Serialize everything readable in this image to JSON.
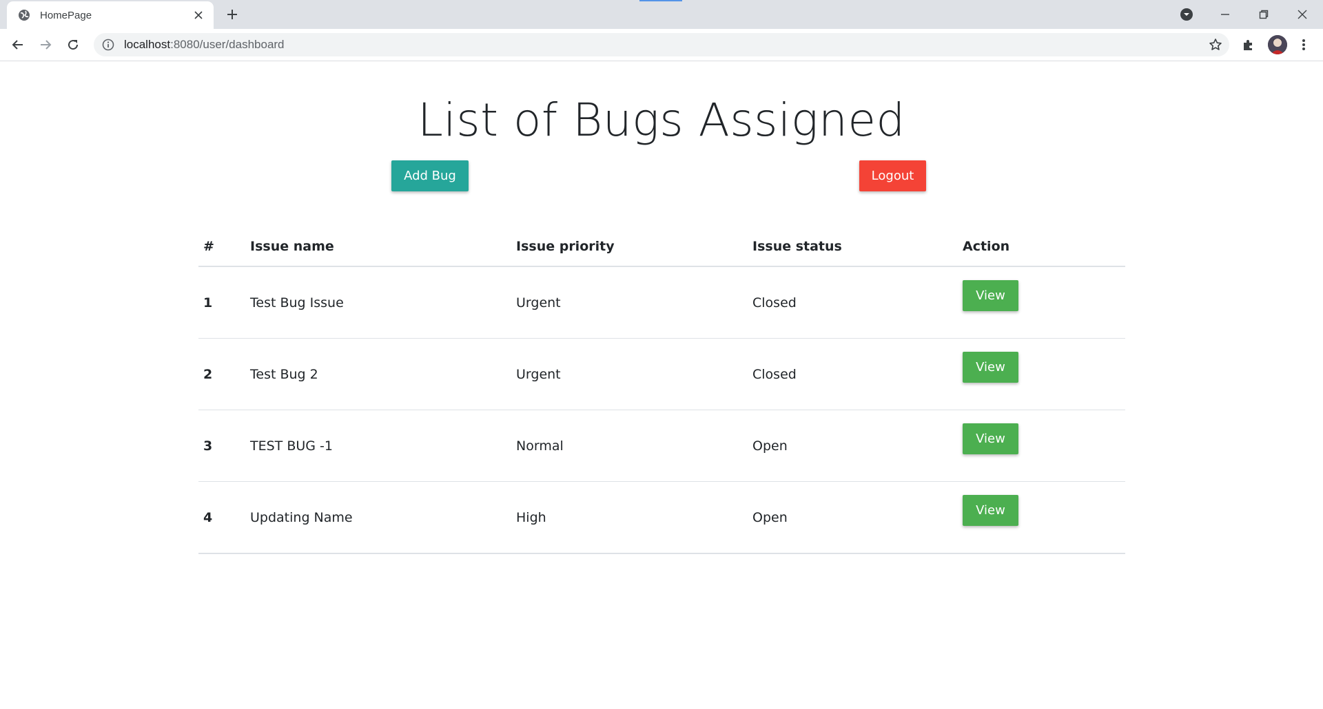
{
  "browser": {
    "tab_title": "HomePage",
    "url_host": "localhost",
    "url_path": ":8080/user/dashboard"
  },
  "page": {
    "title": "List of Bugs Assigned",
    "add_bug_label": "Add Bug",
    "logout_label": "Logout"
  },
  "table": {
    "headers": [
      "#",
      "Issue name",
      "Issue priority",
      "Issue status",
      "Action"
    ],
    "rows": [
      {
        "num": "1",
        "name": "Test Bug Issue",
        "priority": "Urgent",
        "status": "Closed",
        "action": "View"
      },
      {
        "num": "2",
        "name": "Test Bug 2",
        "priority": "Urgent",
        "status": "Closed",
        "action": "View"
      },
      {
        "num": "3",
        "name": "TEST BUG -1",
        "priority": "Normal",
        "status": "Open",
        "action": "View"
      },
      {
        "num": "4",
        "name": "Updating Name",
        "priority": "High",
        "status": "Open",
        "action": "View"
      }
    ]
  },
  "colors": {
    "add_button": "#26a69a",
    "logout_button": "#f44336",
    "view_button": "#4caf50"
  }
}
